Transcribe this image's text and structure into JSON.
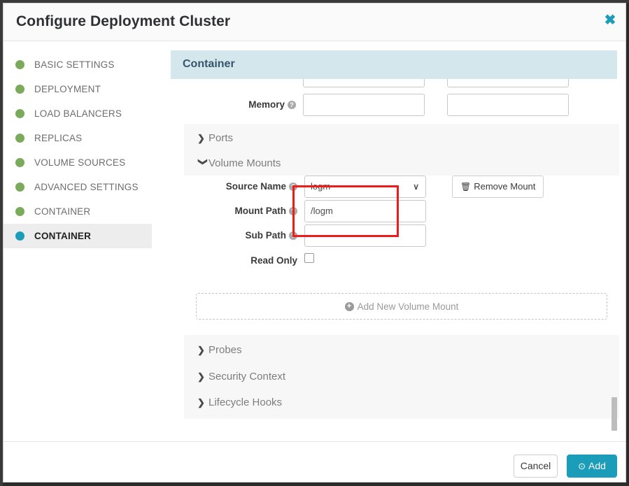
{
  "modal": {
    "title": "Configure Deployment Cluster",
    "close_label": "✖"
  },
  "sidebar": {
    "items": [
      {
        "label": "BASIC SETTINGS",
        "state": "complete"
      },
      {
        "label": "DEPLOYMENT",
        "state": "complete"
      },
      {
        "label": "LOAD BALANCERS",
        "state": "complete"
      },
      {
        "label": "REPLICAS",
        "state": "complete"
      },
      {
        "label": "VOLUME SOURCES",
        "state": "complete"
      },
      {
        "label": "ADVANCED SETTINGS",
        "state": "complete"
      },
      {
        "label": "CONTAINER",
        "state": "complete"
      },
      {
        "label": "CONTAINER",
        "state": "active"
      }
    ]
  },
  "content": {
    "section_title": "Container",
    "memory": {
      "label": "Memory",
      "help": "?",
      "request_value": "",
      "limit_value": ""
    },
    "collapsibles_top": [
      {
        "label": "Ports",
        "caret": "❯",
        "expanded": false
      },
      {
        "label": "Volume Mounts",
        "caret": "❯",
        "expanded": true
      }
    ],
    "volume_mount": {
      "source_name": {
        "label": "Source Name",
        "help": "?",
        "value": "logm",
        "chevron": "∨"
      },
      "mount_path": {
        "label": "Mount Path",
        "help": "?",
        "value": "/logm",
        "placeholder": ""
      },
      "sub_path": {
        "label": "Sub Path",
        "help": "?",
        "value": "",
        "placeholder": ""
      },
      "read_only": {
        "label": "Read Only",
        "checked": false
      },
      "remove_button": {
        "label": "Remove Mount",
        "icon": "🗑"
      },
      "add_button": {
        "label": "Add New Volume Mount",
        "icon": "+"
      }
    },
    "collapsibles_bottom": [
      {
        "label": "Probes",
        "caret": "❯",
        "expanded": false
      },
      {
        "label": "Security Context",
        "caret": "❯",
        "expanded": false
      },
      {
        "label": "Lifecycle Hooks",
        "caret": "❯",
        "expanded": false
      }
    ]
  },
  "footer": {
    "cancel_label": "Cancel",
    "add_label": "Add",
    "add_icon": "⊙"
  },
  "colors": {
    "accent": "#1b9cb9",
    "complete_dot": "#7aab5b",
    "banner_bg": "#d4e7ec",
    "annotation": "#ee1b1b",
    "panel_bg": "#f7f7f7"
  }
}
